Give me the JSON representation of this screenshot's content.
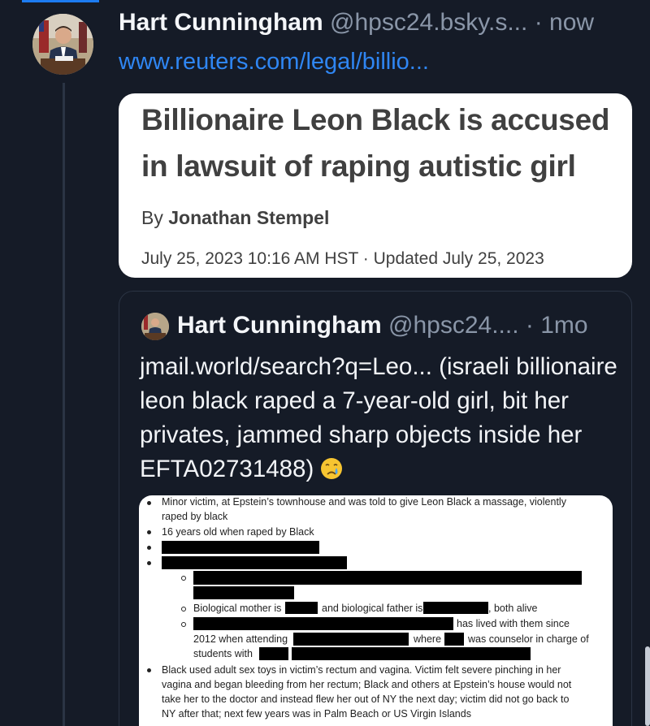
{
  "post": {
    "author_name": "Hart Cunningham",
    "author_handle": "@hpsc24.bsky.s...",
    "separator": "·",
    "time": "now",
    "link_text": "www.reuters.com/legal/billio..."
  },
  "link_card": {
    "title": "Billionaire Leon Black is accused in lawsuit of raping autistic girl",
    "byline_prefix": "By",
    "byline_author": "Jonathan Stempel",
    "date_line": "July 25, 2023 10:16 AM HST · Updated July 25, 2023"
  },
  "quote": {
    "author_name": "Hart Cunningham",
    "author_handle": "@hpsc24....",
    "separator": "·",
    "time": "1mo",
    "text": "jmail.world/search?q=Leo... (israeli billionaire leon black raped a 7-year-old girl, bit her privates, jammed sharp objects inside her EFTA02731488)",
    "emoji": "crying-face"
  },
  "document": {
    "line1": "Minor victim, at Epstein’s townhouse and was told to give Leon Black a massage, violently",
    "line2": "raped by black",
    "line3": "16 years old when raped by Black",
    "sub_bio_a": "Biological mother is",
    "sub_bio_b": "and biological father is",
    "sub_bio_c": ", both alive",
    "sub_lived": "has lived with them since",
    "sub_2012": "2012 when attending",
    "sub_where": "where",
    "sub_counselor": "was counselor in charge of",
    "sub_students": "students with",
    "last1": "Black used adult sex toys in victim’s rectum and vagina. Victim felt severe pinching in her",
    "last2": "vagina and began bleeding from her rectum; Black and others at Epstein’s house would not",
    "last3": "take her to the doctor and instead flew her out of NY the next day; victim did not go back to",
    "last4": "NY after that; next few years was in Palm Beach or US Virgin Islands"
  },
  "colors": {
    "background": "#151b27",
    "accent": "#1d7cf2",
    "link": "#2f86f3",
    "muted": "#8a96a8"
  }
}
